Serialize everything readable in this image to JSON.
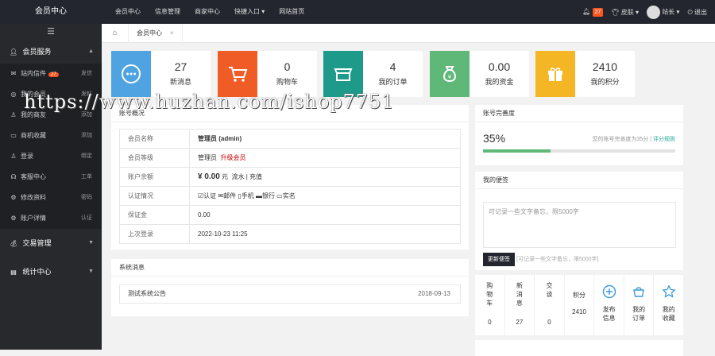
{
  "topbar": {
    "brand": "会员中心",
    "nav": [
      "会员中心",
      "信息管理",
      "商家中心",
      "快捷入口 ▾",
      "网站首页"
    ],
    "notice_count": "27",
    "skin_label": "皮肤",
    "user_name": "站长",
    "logout_label": "退出"
  },
  "sidebar": {
    "toggle": "☰",
    "groups": [
      {
        "label": "会员服务",
        "icon": "user-icon"
      },
      {
        "label": "交易管理",
        "icon": "money-bag-icon"
      },
      {
        "label": "统计中心",
        "icon": "chart-icon"
      }
    ],
    "items": [
      {
        "label": "站内信件",
        "badge": "27",
        "right": "发信"
      },
      {
        "label": "我的会员",
        "right": "发帖"
      },
      {
        "label": "我的商友",
        "right": "添加"
      },
      {
        "label": "商机收藏",
        "right": "添加"
      },
      {
        "label": "登录",
        "right": "绑定"
      },
      {
        "label": "客服中心",
        "right": "工单"
      },
      {
        "label": "修改资料",
        "right": "密码"
      },
      {
        "label": "账户详情",
        "right": "认证"
      }
    ]
  },
  "tabs": {
    "current": "会员中心",
    "close": "×"
  },
  "stats": [
    {
      "value": "27",
      "label": "新消息",
      "color": "#4fa3e0",
      "icon": "chat-icon"
    },
    {
      "value": "0",
      "label": "购物车",
      "color": "#f05c26",
      "icon": "cart-icon"
    },
    {
      "value": "4",
      "label": "我的订单",
      "color": "#1d9a8a",
      "icon": "store-icon"
    },
    {
      "value": "0.00",
      "label": "我的资金",
      "color": "#5fb878",
      "icon": "money-bag-icon"
    },
    {
      "value": "2410",
      "label": "我的积分",
      "color": "#f4b625",
      "icon": "gift-icon"
    }
  ],
  "account": {
    "title": "账号概况",
    "rows": {
      "name_k": "会员名称",
      "name_v": "管理员 (admin)",
      "level_k": "会员等级",
      "level_v": "管理员",
      "level_up": "升级会员",
      "balance_k": "账户余额",
      "balance_v": "¥ 0.00",
      "balance_unit": "元",
      "balance_links": "流水 | 充值",
      "cert_k": "认证情况",
      "cert_v": "☑认证 ✉邮件 ▯手机 ▬银行 ▭实名",
      "deposit_k": "保证金",
      "deposit_v": "0.00",
      "login_k": "上次登录",
      "login_v": "2022-10-23 11:25"
    }
  },
  "sysmsg": {
    "title": "系统消息",
    "item": "测试系统公告",
    "date": "2018-09-13"
  },
  "completion": {
    "title": "账号完善度",
    "percent": 35,
    "percent_text": "35%",
    "tip": "您的账号完善度为35分",
    "link": "评分规则"
  },
  "memo": {
    "title": "我的便签",
    "placeholder": "可记录一些文字备忘，限5000字",
    "save": "更新便签",
    "tip": "[可记录一些文字备忘，限5000字]"
  },
  "quick": {
    "vertical": [
      {
        "label": "购物车",
        "value": "0"
      },
      {
        "label": "新消息",
        "value": "27"
      },
      {
        "label": "交谈",
        "value": "0"
      }
    ],
    "score": {
      "label": "积分",
      "value": "2410"
    },
    "links": [
      {
        "label": "发布信息",
        "icon": "plus-circle-icon"
      },
      {
        "label": "我的订单",
        "icon": "basket-icon"
      },
      {
        "label": "我的收藏",
        "icon": "star-icon"
      }
    ]
  },
  "watermark": "https://www.huzhan.com/ishop7751"
}
